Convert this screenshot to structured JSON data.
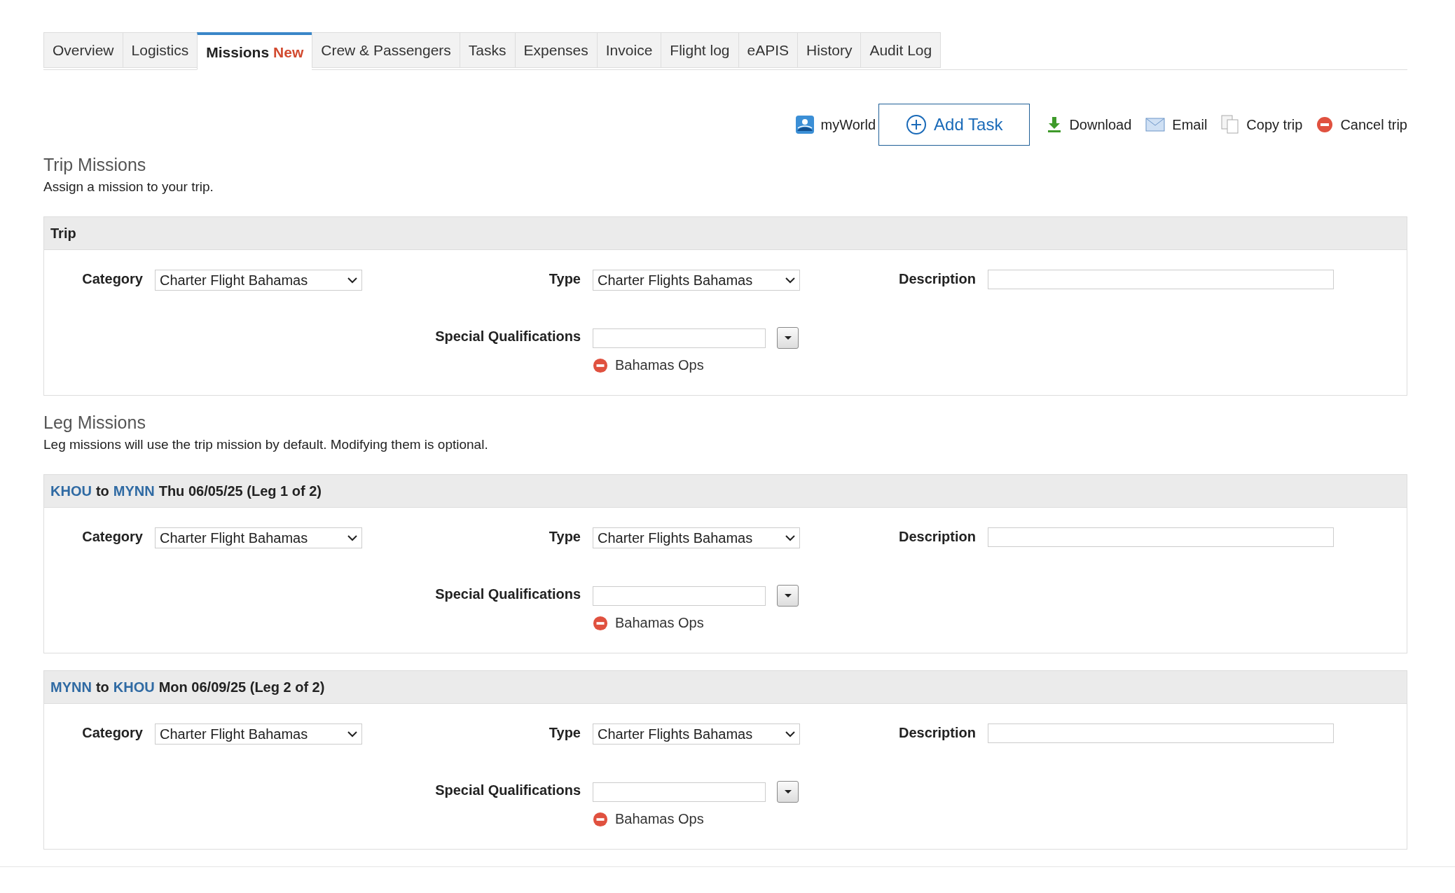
{
  "tabs": [
    {
      "label": "Overview",
      "selected": false
    },
    {
      "label": "Logistics",
      "selected": false
    },
    {
      "label": "Missions",
      "badge": "New",
      "selected": true
    },
    {
      "label": "Crew & Passengers",
      "selected": false
    },
    {
      "label": "Tasks",
      "selected": false
    },
    {
      "label": "Expenses",
      "selected": false
    },
    {
      "label": "Invoice",
      "selected": false
    },
    {
      "label": "Flight log",
      "selected": false
    },
    {
      "label": "eAPIS",
      "selected": false
    },
    {
      "label": "History",
      "selected": false
    },
    {
      "label": "Audit Log",
      "selected": false
    }
  ],
  "actions": [
    {
      "kind": "myworld",
      "label": "myWorld"
    },
    {
      "kind": "add",
      "label": "Add Task"
    },
    {
      "kind": "download",
      "label": "Download"
    },
    {
      "kind": "email",
      "label": "Email"
    },
    {
      "kind": "copy",
      "label": "Copy trip"
    },
    {
      "kind": "cancel",
      "label": "Cancel trip"
    }
  ],
  "trip_missions": {
    "title": "Trip Missions",
    "subtitle": "Assign a mission to your trip.",
    "panel": {
      "title": "Trip",
      "category_label": "Category",
      "category": "Charter Flight Bahamas",
      "type_label": "Type",
      "type": "Charter Flights Bahamas",
      "description_label": "Description",
      "qualifications_label": "Special Qualifications",
      "qualifications": [
        "Bahamas Ops"
      ]
    }
  },
  "leg_missions": {
    "title": "Leg Missions",
    "subtitle": "Leg missions will use the trip mission by default. Modifying them is optional.",
    "legs": [
      {
        "from": "KHOU",
        "connector": "to",
        "to": "MYNN",
        "detail": "Thu 06/05/25 (Leg 1 of 2)",
        "category_label": "Category",
        "category": "Charter Flight Bahamas",
        "type_label": "Type",
        "type": "Charter Flights Bahamas",
        "description_label": "Description",
        "qualifications_label": "Special Qualifications",
        "qualifications": [
          "Bahamas Ops"
        ]
      },
      {
        "from": "MYNN",
        "connector": "to",
        "to": "KHOU",
        "detail": "Mon 06/09/25 (Leg 2 of 2)",
        "category_label": "Category",
        "category": "Charter Flight Bahamas",
        "type_label": "Type",
        "type": "Charter Flights Bahamas",
        "description_label": "Description",
        "qualifications_label": "Special Qualifications",
        "qualifications": [
          "Bahamas Ops"
        ]
      }
    ]
  }
}
